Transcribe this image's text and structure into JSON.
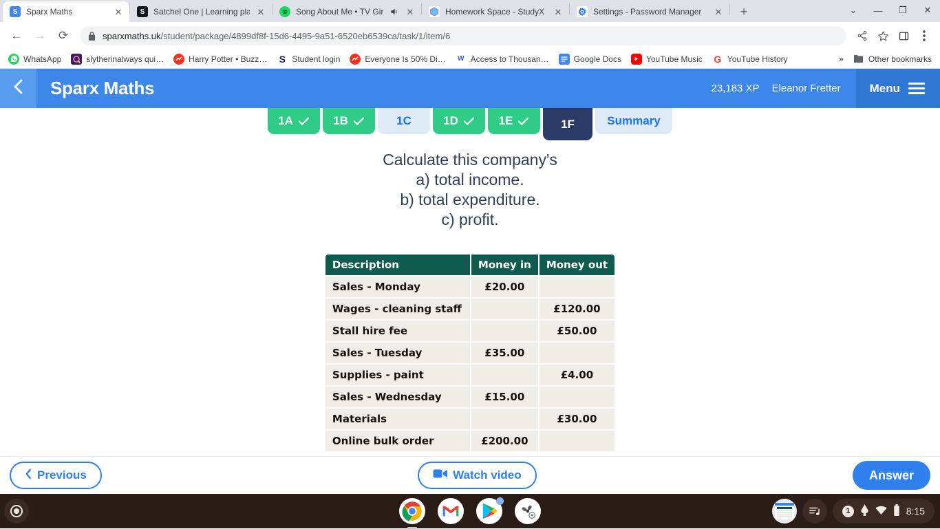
{
  "browser": {
    "tabs": [
      {
        "title": "Sparx Maths",
        "favicon": "sparx-icon",
        "active": true,
        "audio": false
      },
      {
        "title": "Satchel One | Learning platform",
        "favicon": "satchel-icon",
        "active": false,
        "audio": false
      },
      {
        "title": "Song About Me • TV Girl",
        "favicon": "spotify-icon",
        "active": false,
        "audio": true
      },
      {
        "title": "Homework Space - StudyX",
        "favicon": "studyx-icon",
        "active": false,
        "audio": false
      },
      {
        "title": "Settings - Password Manager",
        "favicon": "settings-gear-icon",
        "active": false,
        "audio": false
      }
    ],
    "new_tab_label": "+",
    "window_controls": {
      "minimize": "—",
      "maximize": "❐",
      "close": "✕",
      "tabsearch": "⌄"
    },
    "nav": {
      "back": "←",
      "forward": "→",
      "reload": "⟳"
    },
    "url": {
      "domain": "sparxmaths.uk",
      "path": "/student/package/4899df8f-15d6-4495-9a51-6520eb6539ca/task/1/item/6"
    },
    "omnibox_icons": [
      "share-icon",
      "star-icon",
      "side-panel-icon",
      "kebab-menu-icon"
    ],
    "bookmarks": [
      {
        "label": "WhatsApp",
        "favicon": "whatsapp-icon"
      },
      {
        "label": "slytherinalways qui…",
        "favicon": "quizlet-icon"
      },
      {
        "label": "Harry Potter • Buzz…",
        "favicon": "buzzfeed-icon"
      },
      {
        "label": "Student login",
        "favicon": "sparx-s-icon"
      },
      {
        "label": "Everyone Is 50% Di…",
        "favicon": "buzzfeed-icon"
      },
      {
        "label": "Access to Thousan…",
        "favicon": "wa-icon"
      },
      {
        "label": "Google Docs",
        "favicon": "docs-icon"
      },
      {
        "label": "YouTube Music",
        "favicon": "youtube-icon"
      },
      {
        "label": "YouTube History",
        "favicon": "google-g-icon"
      }
    ],
    "bookmarks_overflow": "»",
    "other_bookmarks": "Other bookmarks"
  },
  "header": {
    "back_icon": "chevron-left-icon",
    "title": "Sparx Maths",
    "xp": "23,183 XP",
    "user": "Eleanor Fretter",
    "menu_label": "Menu",
    "menu_icon": "hamburger-icon",
    "colors": {
      "bar": "#3b86e8",
      "back": "#579ced",
      "menu": "#2f77d4"
    }
  },
  "task_tabs": [
    {
      "label": "1A",
      "state": "done"
    },
    {
      "label": "1B",
      "state": "done"
    },
    {
      "label": "1C",
      "state": "todo"
    },
    {
      "label": "1D",
      "state": "done"
    },
    {
      "label": "1E",
      "state": "done"
    },
    {
      "label": "1F",
      "state": "active"
    },
    {
      "label": "Summary",
      "state": "summary"
    }
  ],
  "question": {
    "lines": [
      "Calculate this company's",
      "a) total income.",
      "b) total expenditure.",
      "c) profit."
    ]
  },
  "table": {
    "headers": [
      "Description",
      "Money in",
      "Money out"
    ],
    "rows": [
      {
        "description": "Sales - Monday",
        "money_in": "£20.00",
        "money_out": ""
      },
      {
        "description": "Wages - cleaning staff",
        "money_in": "",
        "money_out": "£120.00"
      },
      {
        "description": "Stall hire fee",
        "money_in": "",
        "money_out": "£50.00"
      },
      {
        "description": "Sales - Tuesday",
        "money_in": "£35.00",
        "money_out": ""
      },
      {
        "description": "Supplies - paint",
        "money_in": "",
        "money_out": "£4.00"
      },
      {
        "description": "Sales - Wednesday",
        "money_in": "£15.00",
        "money_out": ""
      },
      {
        "description": "Materials",
        "money_in": "",
        "money_out": "£30.00"
      },
      {
        "description": "Online bulk order",
        "money_in": "£200.00",
        "money_out": ""
      }
    ],
    "colors": {
      "header_bg": "#0f5c4f",
      "cell_bg": "#f0ede6"
    }
  },
  "bottom_bar": {
    "previous_label": "Previous",
    "previous_icon": "chevron-left-icon",
    "watch_video_label": "Watch video",
    "watch_video_icon": "video-camera-icon",
    "answer_label": "Answer",
    "accent": "#2f80ed"
  },
  "shelf": {
    "launcher_icon": "launcher-circle-icon",
    "apps": [
      {
        "name": "chrome-icon",
        "running": true
      },
      {
        "name": "gmail-icon",
        "running": false
      },
      {
        "name": "play-store-icon",
        "running": false
      },
      {
        "name": "explore-fan-icon",
        "running": false
      }
    ],
    "tray": {
      "screen_thumb": "window-thumbnail-icon",
      "media_icon": "media-playlist-icon",
      "notification_count": "1",
      "pen_icon": "stylus-icon",
      "wifi_icon": "wifi-icon",
      "battery_icon": "battery-icon",
      "time": "8:15"
    }
  }
}
